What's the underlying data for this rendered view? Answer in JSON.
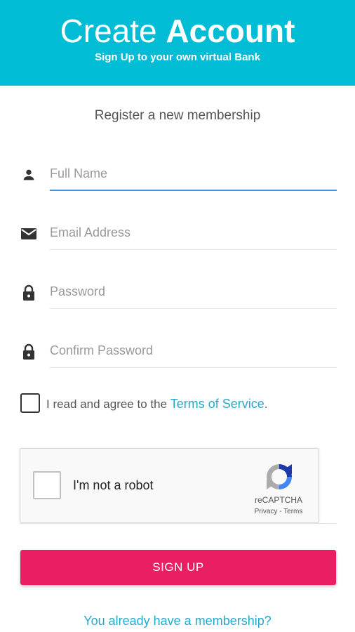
{
  "header": {
    "title_light": "Create",
    "title_bold": "Account",
    "subtitle": "Sign Up to your own virtual Bank"
  },
  "form": {
    "box_msg": "Register a new membership",
    "full_name": {
      "placeholder": "Full Name",
      "value": "",
      "icon": "person-icon"
    },
    "email": {
      "placeholder": "Email Address",
      "value": "",
      "icon": "envelope-icon"
    },
    "password": {
      "placeholder": "Password",
      "value": "",
      "icon": "lock-icon"
    },
    "confirm_password": {
      "placeholder": "Confirm Password",
      "value": "",
      "icon": "lock-icon"
    },
    "terms": {
      "checked": false,
      "text": "I read and agree to the ",
      "link": "Terms of Service",
      "suffix": "."
    },
    "recaptcha": {
      "label": "I'm not a robot",
      "brand": "reCAPTCHA",
      "footer": "Privacy - Terms"
    },
    "submit_label": "SIGN UP",
    "already_member_link": "You already have a membership?"
  },
  "colors": {
    "header_bg": "#00bcd4",
    "button_bg": "#e91e63",
    "link": "#26a9c9",
    "active_underline": "#4a90e2"
  }
}
